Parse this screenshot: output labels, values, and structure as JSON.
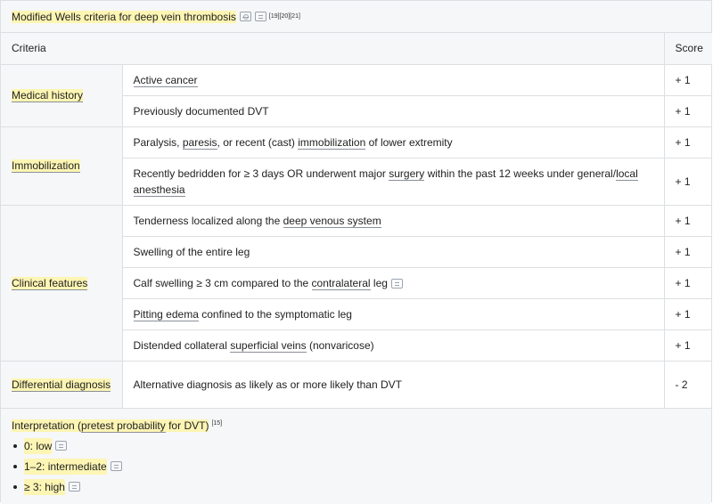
{
  "title": {
    "text": "Modified Wells criteria for deep vein thrombosis",
    "refs": "[19][20][21]"
  },
  "header": {
    "criteria": "Criteria",
    "score": "Score"
  },
  "groups": [
    {
      "category": "Medical history",
      "rows": [
        {
          "parts": [
            {
              "t": "Active cancer",
              "u": true
            }
          ],
          "score": "+ 1"
        },
        {
          "parts": [
            {
              "t": "Previously documented DVT",
              "u": false
            }
          ],
          "score": "+ 1"
        }
      ]
    },
    {
      "category": "Immobilization",
      "rows": [
        {
          "parts": [
            {
              "t": "Paralysis, ",
              "u": false
            },
            {
              "t": "paresis",
              "u": true
            },
            {
              "t": ", or recent (cast) ",
              "u": false
            },
            {
              "t": "immobilization",
              "u": true
            },
            {
              "t": " of lower extremity",
              "u": false
            }
          ],
          "score": "+ 1"
        },
        {
          "parts": [
            {
              "t": "Recently bedridden for ≥ 3 days OR underwent major ",
              "u": false
            },
            {
              "t": "surgery",
              "u": true
            },
            {
              "t": " within the past 12 weeks under general/",
              "u": false
            },
            {
              "t": "local anesthesia",
              "u": true
            }
          ],
          "score": "+ 1"
        }
      ]
    },
    {
      "category": "Clinical features",
      "rows": [
        {
          "parts": [
            {
              "t": "Tenderness localized along the ",
              "u": false
            },
            {
              "t": "deep venous system",
              "u": true
            }
          ],
          "score": "+ 1"
        },
        {
          "parts": [
            {
              "t": "Swelling of the entire leg",
              "u": false
            }
          ],
          "score": "+ 1"
        },
        {
          "parts": [
            {
              "t": "Calf swelling ≥ 3 cm compared to the ",
              "u": false
            },
            {
              "t": "contralateral",
              "u": true
            },
            {
              "t": " leg",
              "u": false
            }
          ],
          "score": "+ 1",
          "note": true
        },
        {
          "parts": [
            {
              "t": "Pitting edema",
              "u": true
            },
            {
              "t": " confined to the symptomatic leg",
              "u": false
            }
          ],
          "score": "+ 1"
        },
        {
          "parts": [
            {
              "t": "Distended collateral ",
              "u": false
            },
            {
              "t": "superficial veins",
              "u": true
            },
            {
              "t": " (nonvaricose)",
              "u": false
            }
          ],
          "score": "+ 1"
        }
      ]
    },
    {
      "category": "Differential diagnosis",
      "rows": [
        {
          "parts": [
            {
              "t": "Alternative diagnosis as likely as or more likely than DVT",
              "u": false
            }
          ],
          "score": "- 2"
        }
      ]
    }
  ],
  "interpretation": {
    "title_prefix": "Interpretation (",
    "title_link": "pretest probability",
    "title_suffix": " for DVT)",
    "ref": "[15]",
    "items": [
      {
        "label": "0: low"
      },
      {
        "label": "1–2: intermediate"
      },
      {
        "label": "≥ 3: high"
      }
    ]
  },
  "colors": {
    "highlight": "#fdf5b3",
    "header_bg": "#f6f7f8",
    "border": "#dcdfe3"
  },
  "icons": [
    "image-icon",
    "note-icon"
  ]
}
